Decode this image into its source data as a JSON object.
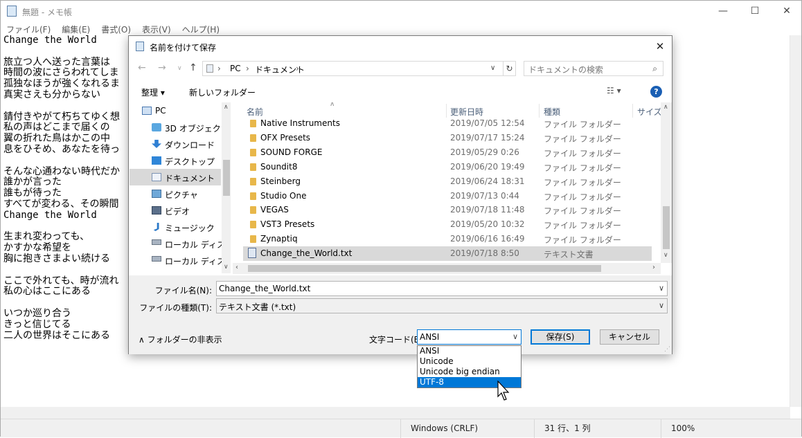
{
  "notepad": {
    "title": "無題 - メモ帳",
    "menu": [
      "ファイル(F)",
      "編集(E)",
      "書式(O)",
      "表示(V)",
      "ヘルプ(H)"
    ],
    "lines": [
      "Change the World",
      "",
      "旅立つ人へ送った言葉は",
      "時間の波にさらわれてしま",
      "孤独なほうが強くなれるま",
      "真実さえも分からない",
      "",
      "錆付きやがて朽ちてゆく想",
      "私の声はどこまで届くの",
      "翼の折れた鳥はかこの中",
      "息をひそめ、あなたを待っ",
      "",
      "そんな心通わない時代だか",
      "誰かが言った",
      "誰もが待った",
      "すべてが変わる、その瞬間",
      "Change the World",
      "",
      "生まれ変わっても、",
      "かすかな希望を",
      "胸に抱きさまよい続ける",
      "",
      "ここで外れても、時が流れ",
      "私の心はここにある",
      "",
      "いつか巡り合う",
      "きっと信じてる",
      "二人の世界はそこにある"
    ],
    "status": {
      "line_ending": "Windows (CRLF)",
      "position": "31 行、1 列",
      "zoom": "100%"
    }
  },
  "dialog": {
    "title": "名前を付けて保存",
    "address": [
      "PC",
      "ドキュメント"
    ],
    "search_placeholder": "ドキュメントの検索",
    "toolbar": {
      "organize": "整理 ▾",
      "new_folder": "新しいフォルダー"
    },
    "nav_items": [
      {
        "label": "PC",
        "icon": "pc-icon"
      },
      {
        "label": "3D オブジェクト",
        "icon": "cube-icon"
      },
      {
        "label": "ダウンロード",
        "icon": "download-icon"
      },
      {
        "label": "デスクトップ",
        "icon": "desktop-icon"
      },
      {
        "label": "ドキュメント",
        "icon": "document-icon",
        "selected": true
      },
      {
        "label": "ピクチャ",
        "icon": "picture-icon"
      },
      {
        "label": "ビデオ",
        "icon": "video-icon"
      },
      {
        "label": "ミュージック",
        "icon": "music-icon"
      },
      {
        "label": "ローカル ディスク (",
        "icon": "disk-icon"
      },
      {
        "label": "ローカル ディスク (",
        "icon": "disk-icon"
      }
    ],
    "columns": [
      "名前",
      "更新日時",
      "種類",
      "サイズ"
    ],
    "files": [
      {
        "name": "Native Instruments",
        "date": "2019/07/05 12:54",
        "type": "ファイル フォルダー",
        "kind": "folder"
      },
      {
        "name": "OFX Presets",
        "date": "2019/07/17 15:24",
        "type": "ファイル フォルダー",
        "kind": "folder"
      },
      {
        "name": "SOUND FORGE",
        "date": "2019/05/29 0:26",
        "type": "ファイル フォルダー",
        "kind": "folder"
      },
      {
        "name": "Soundit8",
        "date": "2019/06/20 19:49",
        "type": "ファイル フォルダー",
        "kind": "folder"
      },
      {
        "name": "Steinberg",
        "date": "2019/06/24 18:31",
        "type": "ファイル フォルダー",
        "kind": "folder"
      },
      {
        "name": "Studio One",
        "date": "2019/07/13 0:44",
        "type": "ファイル フォルダー",
        "kind": "folder"
      },
      {
        "name": "VEGAS",
        "date": "2019/07/18 11:48",
        "type": "ファイル フォルダー",
        "kind": "folder"
      },
      {
        "name": "VST3 Presets",
        "date": "2019/05/20 10:32",
        "type": "ファイル フォルダー",
        "kind": "folder"
      },
      {
        "name": "Zynaptiq",
        "date": "2019/06/16 16:49",
        "type": "ファイル フォルダー",
        "kind": "folder"
      },
      {
        "name": "Change_the_World.txt",
        "date": "2019/07/18 8:50",
        "type": "テキスト文書",
        "kind": "text",
        "selected": true
      }
    ],
    "filename_label": "ファイル名(N):",
    "filename_value": "Change_the_World.txt",
    "filetype_label": "ファイルの種類(T):",
    "filetype_value": "テキスト文書 (*.txt)",
    "hide_folders": "フォルダーの非表示",
    "encoding_label": "文字コード(E):",
    "encoding_value": "ANSI",
    "encoding_options": [
      "ANSI",
      "Unicode",
      "Unicode big endian",
      "UTF-8"
    ],
    "encoding_highlighted": "UTF-8",
    "save_label": "保存(S)",
    "cancel_label": "キャンセル"
  },
  "colors": {
    "accent": "#0078d7",
    "folder": "#e8b74a",
    "selection": "#d9d9d9"
  }
}
